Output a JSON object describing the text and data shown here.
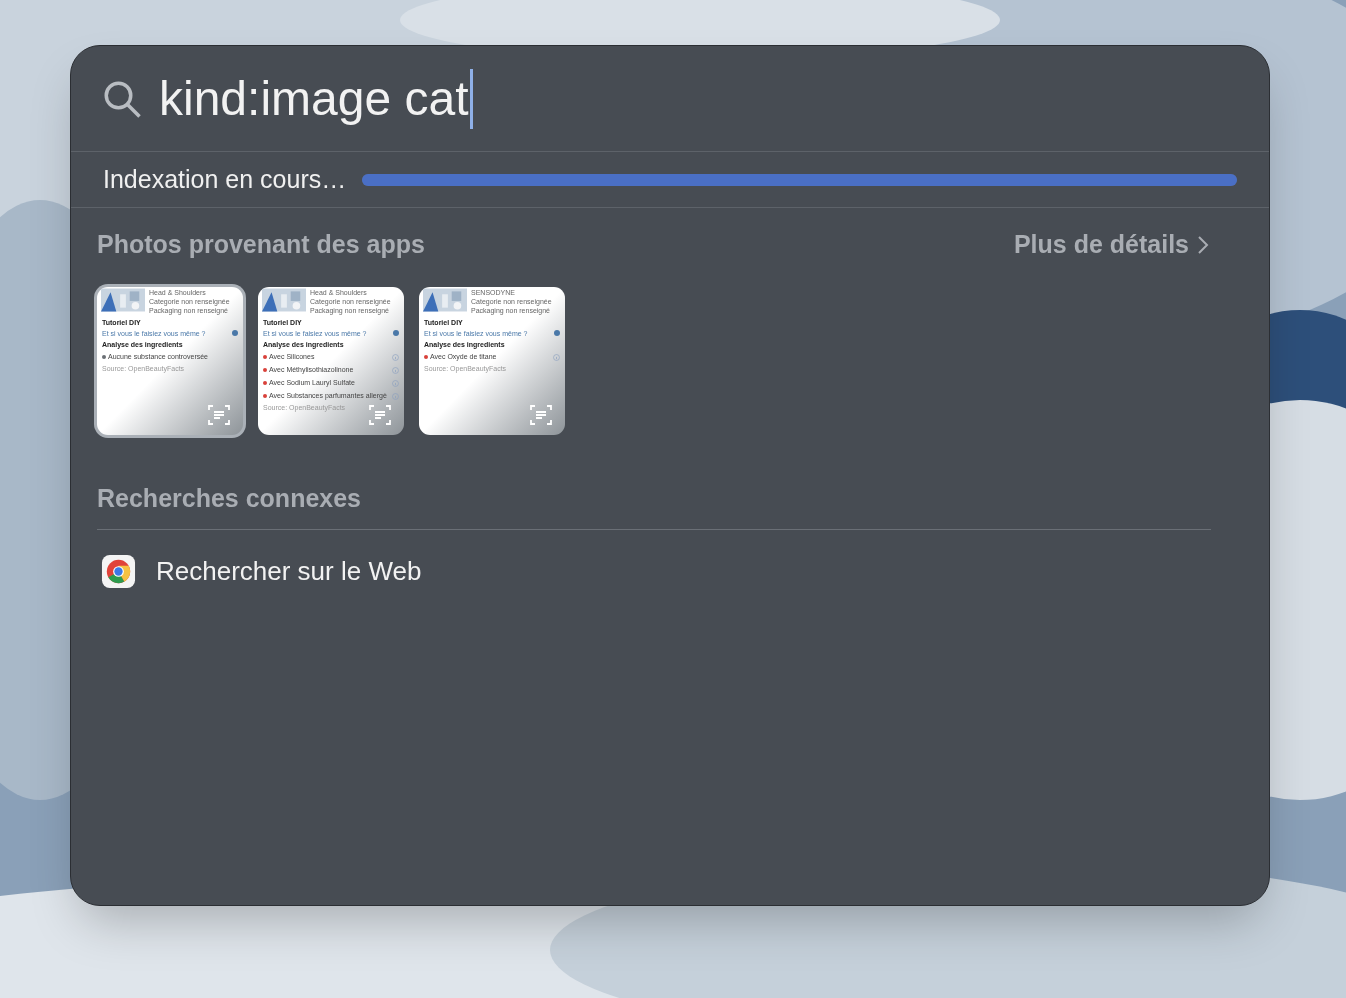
{
  "search": {
    "value": "kind:image cat"
  },
  "indexing": {
    "label": "Indexation en cours…",
    "level": 1
  },
  "photos_section": {
    "title": "Photos provenant des apps",
    "more_link": "Plus de détails",
    "thumbnails": [
      {
        "selected": true,
        "brand": "Head & Shoulders",
        "category": "Categorie non renseignée",
        "packaging": "Packaging non renseigné",
        "tutorial_title": "Tutoriel DIY",
        "tutorial_link": "Et si vous le faisiez vous même ?",
        "analysis_title": "Analyse des ingredients",
        "ingredients": [
          {
            "label": "Aucune substance controversée",
            "color": "#6b7075",
            "info": false
          }
        ],
        "source": "Source: OpenBeautyFacts"
      },
      {
        "selected": false,
        "brand": "Head & Shoulders",
        "category": "Categorie non renseignée",
        "packaging": "Packaging non renseigné",
        "tutorial_title": "Tutoriel DIY",
        "tutorial_link": "Et si vous le faisiez vous même ?",
        "analysis_title": "Analyse des ingredients",
        "ingredients": [
          {
            "label": "Avec Silicones",
            "color": "#d9413a",
            "info": true
          },
          {
            "label": "Avec Méthylisothiazolinone",
            "color": "#d9413a",
            "info": true
          },
          {
            "label": "Avec Sodium Lauryl Sulfate",
            "color": "#d9413a",
            "info": true
          },
          {
            "label": "Avec Substances parfumantes allergè",
            "color": "#d9413a",
            "info": true
          }
        ],
        "source": "Source: OpenBeautyFacts"
      },
      {
        "selected": false,
        "brand": "SENSODYNE",
        "category": "Categorie non renseignée",
        "packaging": "Packaging non renseigné",
        "tutorial_title": "Tutoriel DIY",
        "tutorial_link": "Et si vous le faisiez vous même ?",
        "analysis_title": "Analyse des ingredients",
        "ingredients": [
          {
            "label": "Avec Oxyde de titane",
            "color": "#d9413a",
            "info": true
          }
        ],
        "source": "Source: OpenBeautyFacts"
      }
    ]
  },
  "related": {
    "title": "Recherches connexes",
    "items": [
      {
        "label": "Rechercher sur le Web"
      }
    ]
  }
}
